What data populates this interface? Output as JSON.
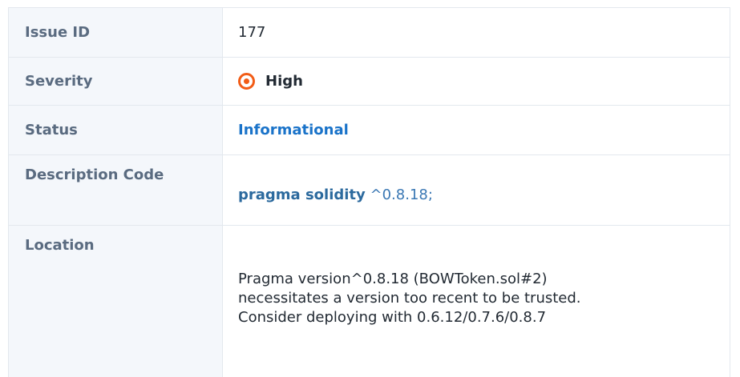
{
  "rows": {
    "issue_id": {
      "label": "Issue ID",
      "value": "177"
    },
    "severity": {
      "label": "Severity",
      "value": "High",
      "icon": "target-icon",
      "icon_color": "#f25c16"
    },
    "status": {
      "label": "Status",
      "value": "Informational",
      "color": "#1a73c9"
    },
    "description_code": {
      "label": "Description Code",
      "keyword": "pragma solidity",
      "rest": "^0.8.18;"
    },
    "location": {
      "label": "Location",
      "lines": [
        "Pragma version^0.8.18 (BOWToken.sol#2)",
        "necessitates a version too recent to be trusted.",
        "Consider deploying with 0.6.12/0.7.6/0.8.7"
      ]
    }
  }
}
